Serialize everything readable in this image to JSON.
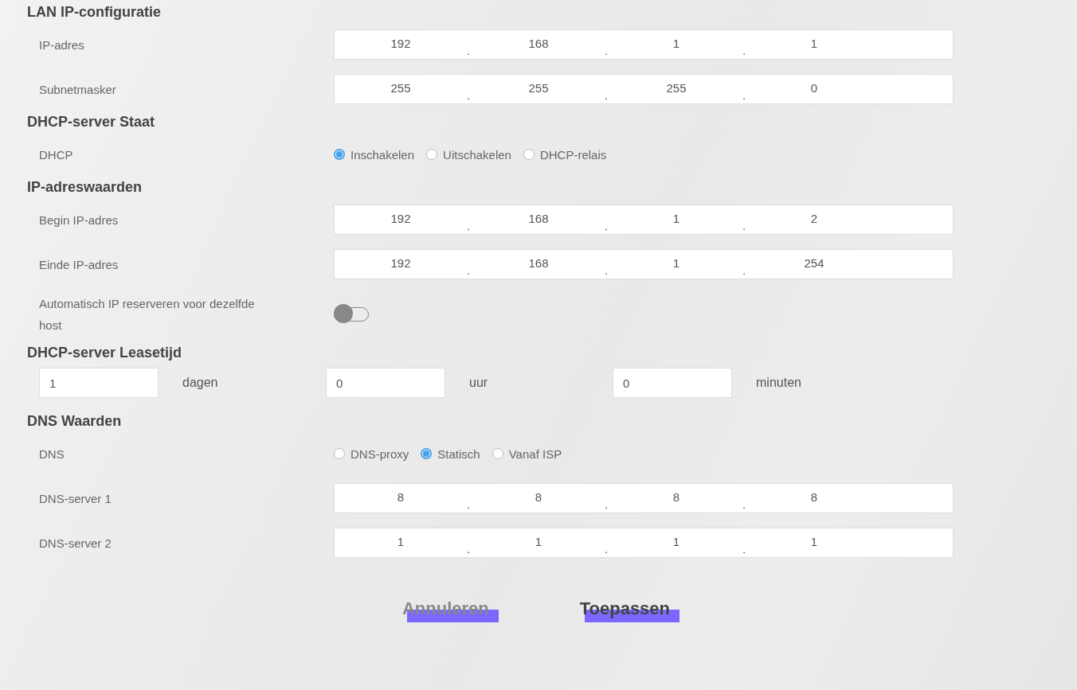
{
  "sections": [
    {
      "title": "LAN IP-configuratie",
      "rows": [
        {
          "kind": "ip",
          "label": "IP-adres",
          "separator": ".",
          "octets": [
            "192",
            "168",
            "1",
            "1"
          ]
        },
        {
          "kind": "ip",
          "label": "Subnetmasker",
          "separator": ".",
          "octets": [
            "255",
            "255",
            "255",
            "0"
          ]
        }
      ]
    },
    {
      "title": "DHCP-server Staat",
      "rows": [
        {
          "kind": "radio",
          "label": "DHCP",
          "options": [
            {
              "label": "Inschakelen",
              "selected": true
            },
            {
              "label": "Uitschakelen",
              "selected": false
            },
            {
              "label": "DHCP-relais",
              "selected": false
            }
          ]
        }
      ]
    },
    {
      "title": "IP-adreswaarden",
      "rows": [
        {
          "kind": "ip",
          "label": "Begin IP-adres",
          "separator": ".",
          "octets": [
            "192",
            "168",
            "1",
            "2"
          ]
        },
        {
          "kind": "ip",
          "label": "Einde IP-adres",
          "separator": ".",
          "octets": [
            "192",
            "168",
            "1",
            "254"
          ]
        },
        {
          "kind": "toggle",
          "label": "Automatisch IP reserveren voor dezelfde host",
          "on": false
        }
      ]
    },
    {
      "title": "DHCP-server Leasetijd",
      "rows": [
        {
          "kind": "lease",
          "fields": [
            {
              "value": "1",
              "unit": "dagen"
            },
            {
              "value": "0",
              "unit": "uur"
            },
            {
              "value": "0",
              "unit": "minuten"
            }
          ]
        }
      ]
    },
    {
      "title": "DNS Waarden",
      "rows": [
        {
          "kind": "radio",
          "label": "DNS",
          "options": [
            {
              "label": "DNS-proxy",
              "selected": false
            },
            {
              "label": "Statisch",
              "selected": true
            },
            {
              "label": "Vanaf ISP",
              "selected": false
            }
          ]
        },
        {
          "kind": "ip",
          "label": "DNS-server 1",
          "separator": ".",
          "octets": [
            "8",
            "8",
            "8",
            "8"
          ]
        },
        {
          "kind": "ip",
          "label": "DNS-server 2",
          "separator": ".",
          "octets": [
            "1",
            "1",
            "1",
            "1"
          ]
        }
      ]
    }
  ],
  "buttons": [
    {
      "label": "Annuleren",
      "kind": "cancel"
    },
    {
      "label": "Toepassen",
      "kind": "apply"
    }
  ]
}
